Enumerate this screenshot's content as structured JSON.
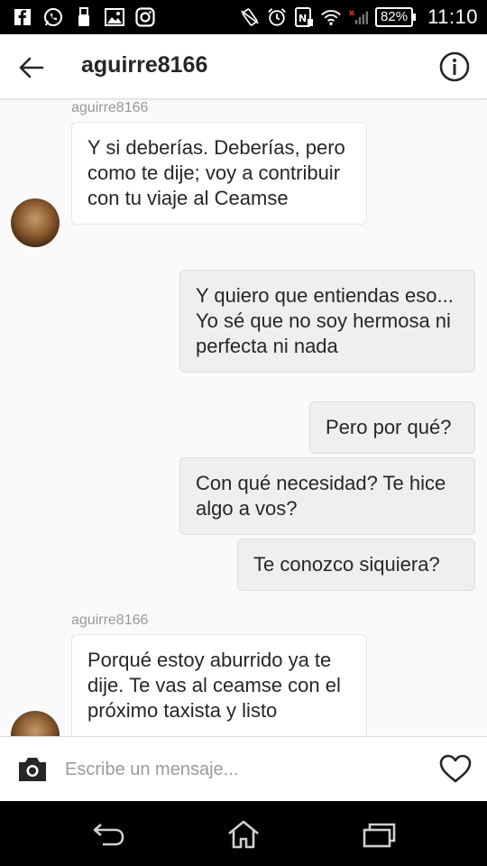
{
  "status_bar": {
    "icons_left": [
      "facebook-icon",
      "whatsapp-icon",
      "usb-icon",
      "image-icon",
      "instagram-icon"
    ],
    "icons_right": [
      "vibrate-icon",
      "alarm-icon",
      "nfc-icon",
      "wifi-icon",
      "signal-icon"
    ],
    "battery": "82%",
    "time": "11:10"
  },
  "header": {
    "title": "aguirre8166"
  },
  "messages": [
    {
      "sender": "aguirre8166",
      "text": "Y si deberías. Deberías, pero como te dije; voy a contribuir con tu viaje al Ceamse",
      "direction": "in"
    },
    {
      "text": "Y quiero que entiendas eso... Yo sé que no soy hermosa ni perfecta ni nada",
      "direction": "out"
    },
    {
      "text": "Pero por qué?",
      "direction": "out"
    },
    {
      "text": "Con qué necesidad? Te hice algo a vos?",
      "direction": "out"
    },
    {
      "text": "Te conozco siquiera?",
      "direction": "out"
    },
    {
      "sender": "aguirre8166",
      "text": "Porqué estoy aburrido ya te dije. Te vas al ceamse con el próximo taxista y listo",
      "direction": "in"
    }
  ],
  "composer": {
    "placeholder": "Escribe un mensaje..."
  },
  "colors": {
    "incoming_bg": "#ffffff",
    "outgoing_bg": "#efefef",
    "text": "#262626",
    "secondary": "#999999"
  }
}
